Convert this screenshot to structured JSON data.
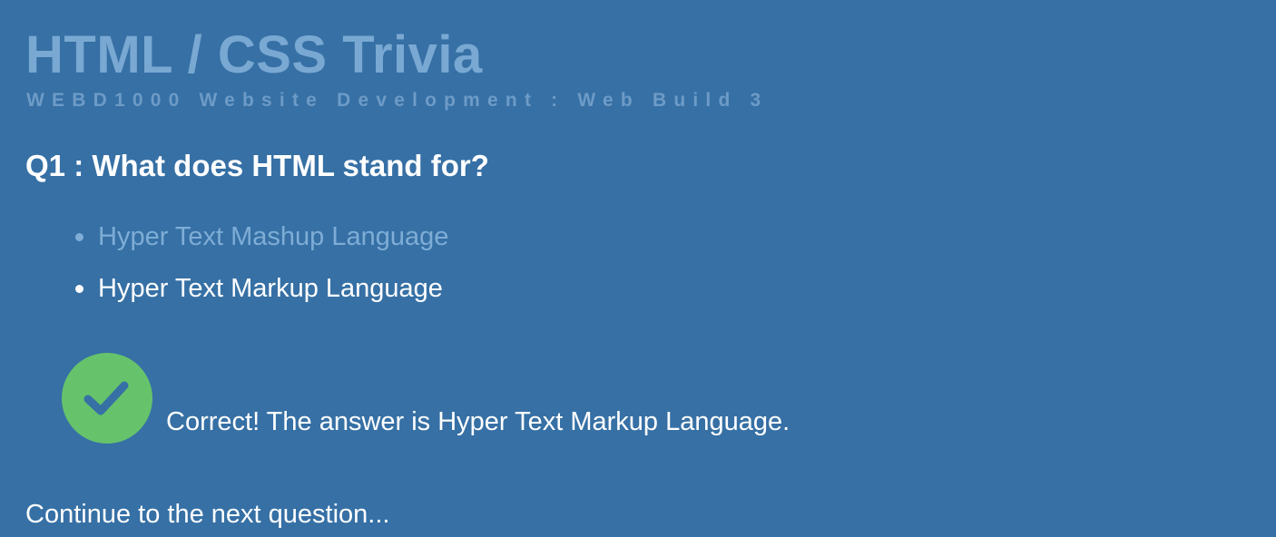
{
  "header": {
    "title": "HTML / CSS Trivia",
    "subtitle": "WEBD1000 Website Development : Web Build 3"
  },
  "question": {
    "text": "Q1 : What does HTML stand for?",
    "options": [
      {
        "label": "Hyper Text Mashup Language",
        "state": "dimmed"
      },
      {
        "label": "Hyper Text Markup Language",
        "state": "selected"
      }
    ]
  },
  "result": {
    "icon": "check-circle-icon",
    "status": "correct",
    "message": "Correct! The answer is Hyper Text Markup Language."
  },
  "navigation": {
    "continue_label": "Continue to the next question..."
  },
  "colors": {
    "background": "#3670a5",
    "title": "#79a8d2",
    "dimmed_option": "#7eadd6",
    "success": "#66c36b",
    "text": "#ffffff"
  }
}
